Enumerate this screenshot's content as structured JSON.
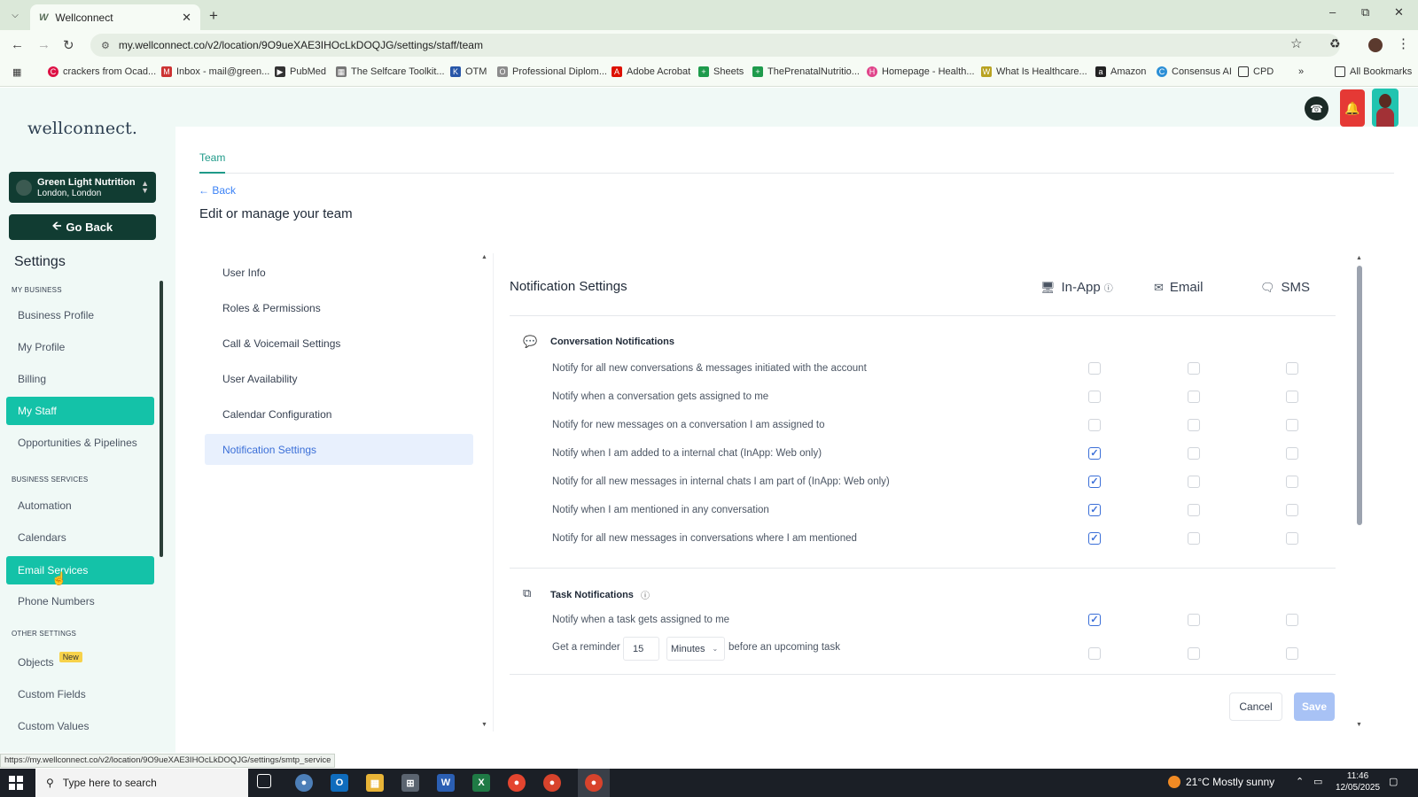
{
  "browser": {
    "tab_title": "Wellconnect",
    "url": "my.wellconnect.co/v2/location/9O9ueXAE3IHOcLkDOQJG/settings/staff/team",
    "status_url": "https://my.wellconnect.co/v2/location/9O9ueXAE3IHOcLkDOQJG/settings/smtp_service",
    "bookmarks": [
      "crackers from Ocad...",
      "Inbox - mail@green...",
      "PubMed",
      "The Selfcare Toolkit...",
      "OTM",
      "Professional Diplom...",
      "Adobe Acrobat",
      "Sheets",
      "ThePrenatalNutritio...",
      "Homepage - Health...",
      "What Is Healthcare...",
      "Amazon",
      "Consensus AI",
      "CPD"
    ],
    "all_bookmarks": "All Bookmarks"
  },
  "sidebar": {
    "logo": "wellconnect.",
    "account_name": "Green Light Nutrition",
    "account_location": "London, London",
    "go_back": "Go Back",
    "settings_heading": "Settings",
    "section_my_business": "MY BUSINESS",
    "section_business_services": "BUSINESS SERVICES",
    "section_other_settings": "OTHER SETTINGS",
    "items": {
      "business_profile": "Business Profile",
      "my_profile": "My Profile",
      "billing": "Billing",
      "my_staff": "My Staff",
      "opportunities": "Opportunities & Pipelines",
      "automation": "Automation",
      "calendars": "Calendars",
      "email_services": "Email Services",
      "phone_numbers": "Phone Numbers",
      "objects": "Objects",
      "objects_badge": "New",
      "custom_fields": "Custom Fields",
      "custom_values": "Custom Values"
    }
  },
  "header": {
    "tab_team": "Team",
    "back": "Back",
    "page_title": "Edit or manage your team"
  },
  "subnav": [
    "User Info",
    "Roles & Permissions",
    "Call & Voicemail Settings",
    "User Availability",
    "Calendar Configuration",
    "Notification Settings"
  ],
  "panel": {
    "title": "Notification Settings",
    "col_inapp": "In-App",
    "col_email": "Email",
    "col_sms": "SMS",
    "conversation_title": "Conversation Notifications",
    "conversation_rows": [
      {
        "label": "Notify for all new conversations & messages initiated with the account",
        "inapp": false,
        "email": false,
        "sms": false
      },
      {
        "label": "Notify when a conversation gets assigned to me",
        "inapp": false,
        "email": false,
        "sms": false
      },
      {
        "label": "Notify for new messages on a conversation I am assigned to",
        "inapp": false,
        "email": false,
        "sms": false
      },
      {
        "label": "Notify when I am added to a internal chat (InApp: Web only)",
        "inapp": true,
        "email": false,
        "sms": false
      },
      {
        "label": "Notify for all new messages in internal chats I am part of (InApp: Web only)",
        "inapp": true,
        "email": false,
        "sms": false
      },
      {
        "label": "Notify when I am mentioned in any conversation",
        "inapp": true,
        "email": false,
        "sms": false
      },
      {
        "label": "Notify for all new messages in conversations where I am mentioned",
        "inapp": true,
        "email": false,
        "sms": false
      }
    ],
    "task_title": "Task Notifications",
    "task_rows": [
      {
        "label": "Notify when a task gets assigned to me",
        "inapp": true,
        "email": false,
        "sms": false
      }
    ],
    "reminder": {
      "prefix": "Get a reminder",
      "value": "15",
      "unit": "Minutes",
      "suffix": "before an upcoming task",
      "inapp": false,
      "email": false,
      "sms": false
    },
    "cancel": "Cancel",
    "save": "Save"
  },
  "taskbar": {
    "search_placeholder": "Type here to search",
    "weather": "21°C  Mostly sunny",
    "time": "11:46",
    "date": "12/05/2025"
  }
}
